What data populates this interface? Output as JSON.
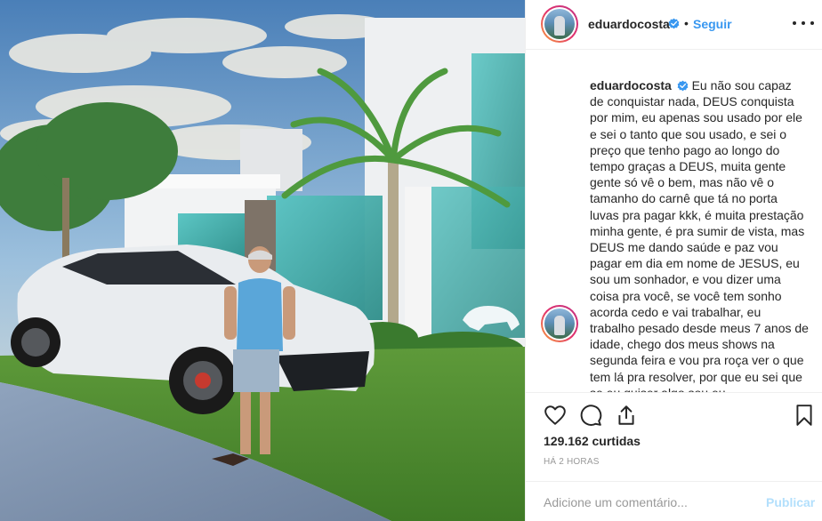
{
  "header": {
    "username": "eduardocosta",
    "separator": "•",
    "follow_label": "Seguir",
    "verified_icon": "verified-badge-icon",
    "more_icon": "more-options-icon"
  },
  "caption": {
    "username": "eduardocosta",
    "text": "Eu não sou capaz de conquistar nada, DEUS conquista por mim, eu apenas sou usado por ele e sei o tanto que sou usado, e sei o preço que tenho pago ao longo do tempo graças a DEUS, muita gente gente só vê o bem, mas não vê o tamanho do carnê que tá no porta luvas pra pagar kkk, é muita prestação minha gente, é pra sumir de vista, mas DEUS me dando saúde e paz vou pagar em dia em nome de JESUS, eu sou um sonhador, e vou dizer uma coisa pra você, se você tem sonho acorda cedo e vai trabalhar, eu trabalho pesado desde meus 7 anos de idade, chego dos meus shows na segunda feira e vou pra roça ver o que tem lá pra resolver, por que eu sei que se eu quiser algo sou eu"
  },
  "actions": {
    "like_icon": "heart-icon",
    "comment_icon": "comment-icon",
    "share_icon": "share-icon",
    "save_icon": "bookmark-icon"
  },
  "likes": "129.162 curtidas",
  "timestamp": "HÁ 2 HORAS",
  "comment_box": {
    "placeholder": "Adicione um comentário...",
    "publish_label": "Publicar"
  },
  "colors": {
    "link_blue": "#3897f0",
    "publish_disabled": "#b2dffc",
    "border": "#efefef",
    "muted_text": "#999999"
  }
}
